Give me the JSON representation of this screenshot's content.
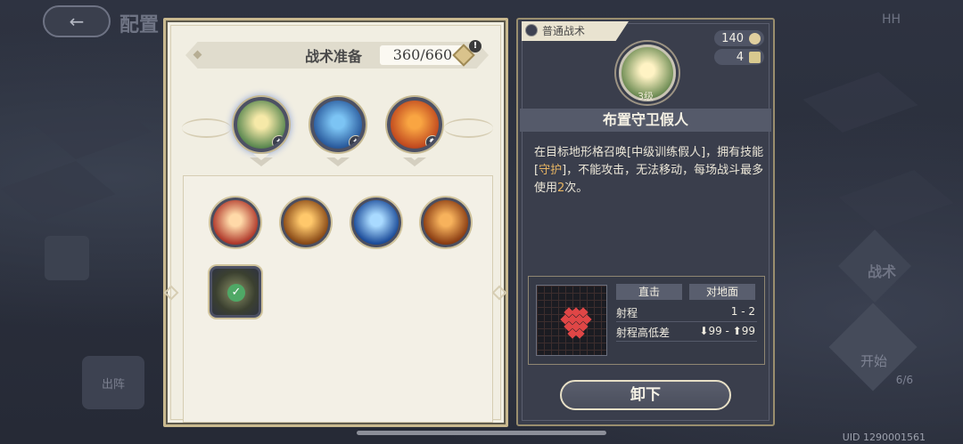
{
  "background": {
    "title_fragment": "配置",
    "deploy_label": "出阵",
    "tactic_btn_label": "战术",
    "start_label": "开始",
    "deploy_count": "6/6",
    "top_right_fragment": "HH",
    "uid": "UID 1290001561"
  },
  "tactical_prep": {
    "label": "战术准备",
    "value": "360/660",
    "alert": "!"
  },
  "slots": [
    {
      "name": "summon-decoy",
      "icon": "dummy-icon",
      "colors": [
        "#f6e9a8",
        "#5e8a52"
      ]
    },
    {
      "name": "sprint",
      "icon": "running-icon",
      "colors": [
        "#7cc4f4",
        "#2b5c9e"
      ]
    },
    {
      "name": "resist",
      "icon": "shield-rune-icon",
      "colors": [
        "#f9a542",
        "#c14a1f"
      ]
    }
  ],
  "tactics": [
    {
      "name": "fire-slash",
      "icon": "flame-icon",
      "colors": [
        "#ffd9a8",
        "#b03a2c"
      ]
    },
    {
      "name": "power-pose",
      "icon": "strength-icon",
      "colors": [
        "#ffc86b",
        "#8a4b18"
      ]
    },
    {
      "name": "team-buff",
      "icon": "allies-icon",
      "colors": [
        "#a9daff",
        "#1d4d9a"
      ]
    },
    {
      "name": "charge",
      "icon": "dash-icon",
      "colors": [
        "#f7b25c",
        "#8b3e14"
      ]
    },
    {
      "name": "equipped-decoy",
      "icon": "dummy-icon",
      "colors": [
        "#8a9066",
        "#3b4030"
      ],
      "equipped": true
    }
  ],
  "detail": {
    "category": "普通战术",
    "cost": "140",
    "uses": "4",
    "level": "3级",
    "name": "布置守卫假人",
    "desc_1": "在目标地形格召唤[中级训练假人]，拥有技能",
    "desc_bracket_open": "[",
    "desc_skill": "守护",
    "desc_2": "]，不能攻击，无法移动，每场战斗最多",
    "desc_3": "使用",
    "desc_num": "2",
    "desc_4": "次。",
    "range": {
      "type_label": "直击",
      "target_label": "对地面",
      "range_label": "射程",
      "range_value": "1 - 2",
      "height_label": "射程高低差",
      "height_value": "⬇99 - ⬆99"
    },
    "unequip_label": "卸下"
  },
  "colors": {
    "panel_light": "#f1eee2",
    "panel_dark": "#3a3e4c",
    "gold_border": "#c9b98f",
    "highlight": "#e8b563",
    "range_red": "#e04646"
  }
}
